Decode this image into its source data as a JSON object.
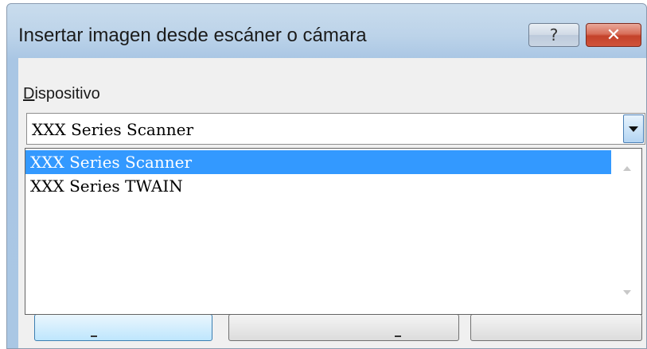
{
  "window": {
    "title": "Insertar imagen desde escáner o cámara",
    "help_glyph": "?",
    "close_glyph": "✕"
  },
  "device": {
    "label_accel": "D",
    "label_rest": "ispositivo",
    "selected_value": "XXX Series Scanner",
    "options": [
      {
        "label": "XXX Series Scanner",
        "selected": true
      },
      {
        "label": "XXX Series TWAIN",
        "selected": false
      }
    ]
  },
  "colors": {
    "selection": "#3399ff",
    "close_button": "#c4422a",
    "title_bar": "#bcd3e9"
  }
}
